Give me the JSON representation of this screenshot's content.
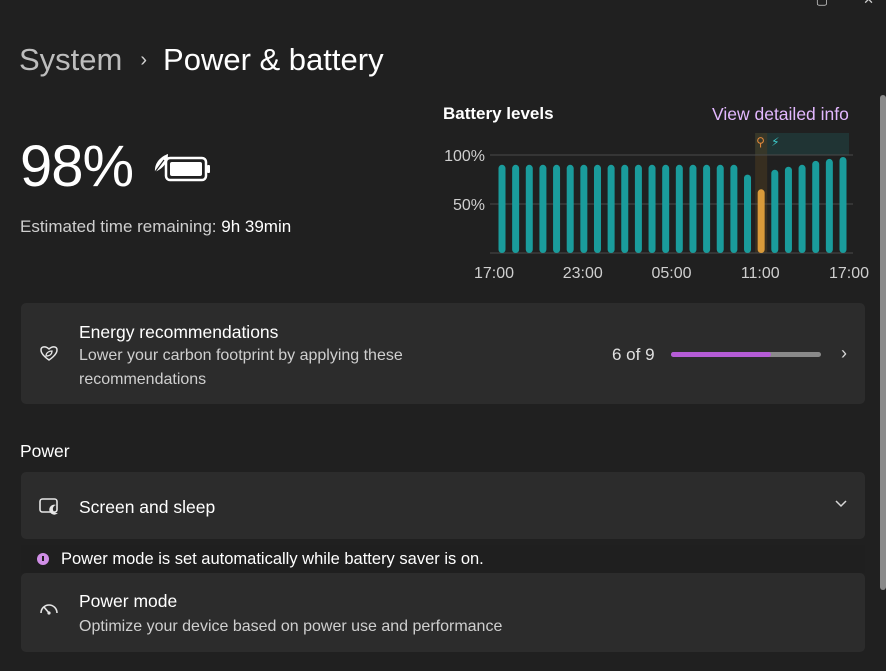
{
  "breadcrumb": {
    "parent": "System",
    "separator": "›",
    "current": "Power & battery"
  },
  "battery": {
    "percent_text": "98%",
    "estimated_label": "Estimated time remaining:",
    "estimated_value": "9h 39min"
  },
  "levels": {
    "title": "Battery levels",
    "link": "View detailed info"
  },
  "chart_data": {
    "type": "bar",
    "title": "Battery levels",
    "yticks": [
      "100%",
      "50%"
    ],
    "xticks": [
      "17:00",
      "23:00",
      "05:00",
      "11:00",
      "17:00"
    ],
    "ylim": [
      0,
      100
    ],
    "grid": true,
    "values": [
      90,
      90,
      90,
      90,
      90,
      90,
      90,
      90,
      90,
      90,
      90,
      90,
      90,
      90,
      90,
      90,
      90,
      90,
      80,
      65,
      85,
      88,
      90,
      94,
      96,
      98
    ],
    "highlight_index": 19,
    "colors": {
      "bar": "#1a9c9c",
      "highlight": "#d99a3a",
      "grid": "#4a4a4a",
      "plug_icon": "#e0883a",
      "bolt_icon": "#3dc9c9"
    }
  },
  "energy": {
    "title": "Energy recommendations",
    "subtitle": "Lower your carbon footprint by applying these recommendations",
    "count_text": "6 of 9",
    "progress_fraction": 0.667
  },
  "power_section": {
    "title": "Power"
  },
  "screen_sleep": {
    "title": "Screen and sleep"
  },
  "notice": {
    "text": "Power mode is set automatically while battery saver is on."
  },
  "power_mode": {
    "title": "Power mode",
    "subtitle": "Optimize your device based on power use and performance"
  }
}
